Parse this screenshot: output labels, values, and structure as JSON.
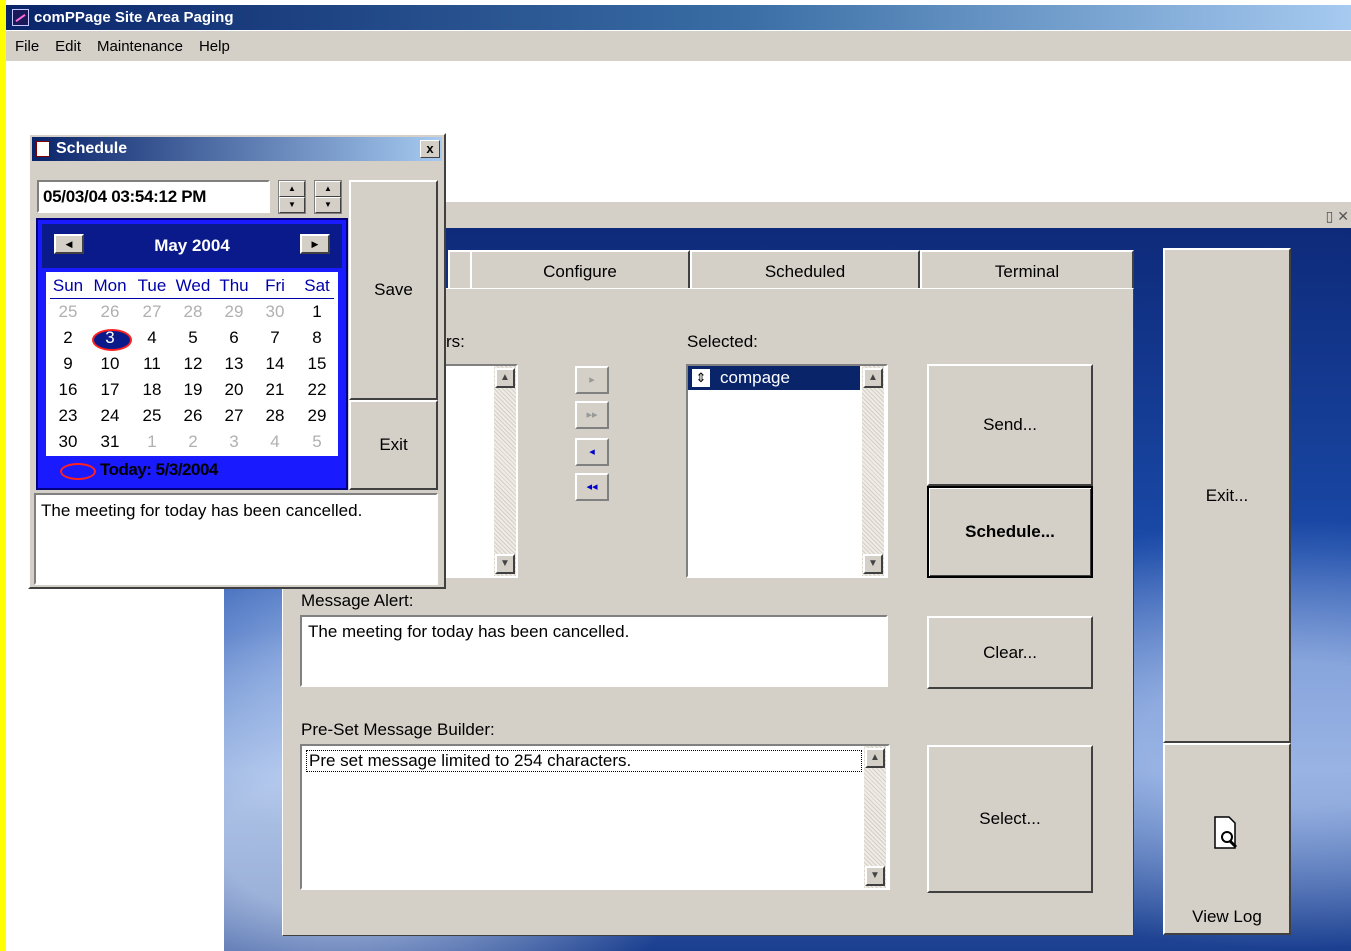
{
  "app": {
    "title": "comPPage Site Area Paging",
    "menu": [
      "File",
      "Edit",
      "Maintenance",
      "Help"
    ]
  },
  "main": {
    "tabs": [
      "Configure",
      "Scheduled",
      "Terminal"
    ],
    "available_label_fragment": "rs:",
    "selected_label": "Selected:",
    "selected_items": [
      "compage"
    ],
    "message_alert_label": "Message Alert:",
    "message_alert_value": "The meeting for today has been cancelled.",
    "preset_label": "Pre-Set Message Builder:",
    "preset_value": "Pre set message limited to 254 characters.",
    "buttons": {
      "send": "Send...",
      "schedule": "Schedule...",
      "clear": "Clear...",
      "select": "Select...",
      "exit": "Exit...",
      "view_log": "View Log"
    },
    "transfer_arrows": [
      "▸",
      "▸▸",
      "◂",
      "◂◂"
    ]
  },
  "schedule_dialog": {
    "title": "Schedule",
    "close": "x",
    "datetime": "05/03/04 03:54:12 PM",
    "save": "Save",
    "exit": "Exit",
    "message": "The meeting for today has been cancelled.",
    "calendar": {
      "month_year": "May 2004",
      "weekdays": [
        "Sun",
        "Mon",
        "Tue",
        "Wed",
        "Thu",
        "Fri",
        "Sat"
      ],
      "weeks": [
        [
          "25",
          "26",
          "27",
          "28",
          "29",
          "30",
          "1"
        ],
        [
          "2",
          "3",
          "4",
          "5",
          "6",
          "7",
          "8"
        ],
        [
          "9",
          "10",
          "11",
          "12",
          "13",
          "14",
          "15"
        ],
        [
          "16",
          "17",
          "18",
          "19",
          "20",
          "21",
          "22"
        ],
        [
          "23",
          "24",
          "25",
          "26",
          "27",
          "28",
          "29"
        ],
        [
          "30",
          "31",
          "1",
          "2",
          "3",
          "4",
          "5"
        ]
      ],
      "selected_day": "3",
      "today_label": "Today: 5/3/2004"
    }
  }
}
